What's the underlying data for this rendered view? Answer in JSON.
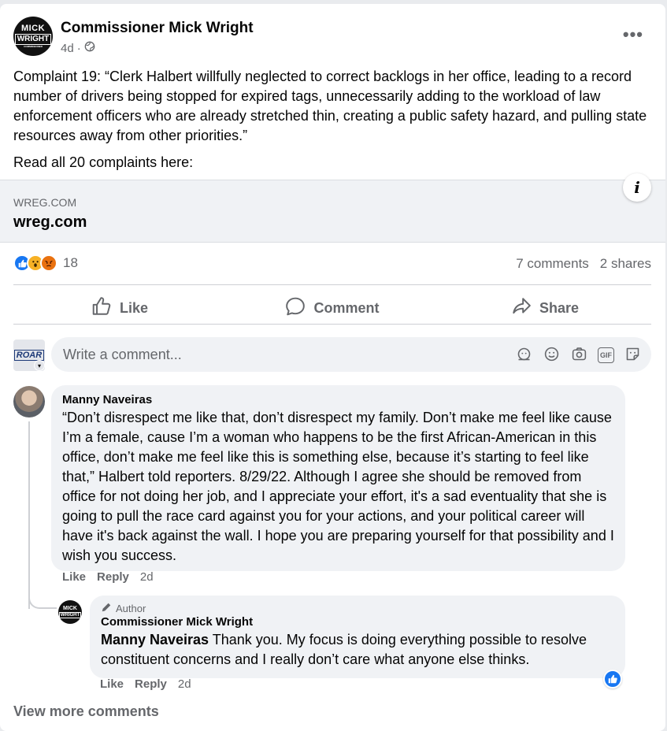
{
  "post": {
    "author": "Commissioner Mick Wright",
    "logo_line1": "MICK",
    "logo_line2": "WRIGHT",
    "logo_line3": "COMMISSIONER",
    "age": "4d",
    "separator": "·",
    "privacy_icon": "globe-icon",
    "more_icon": "more-icon",
    "more_label": "•••",
    "text": "Complaint 19: “Clerk Halbert willfully neglected to correct backlogs in her office, leading to a record number of drivers being stopped for expired tags, unnecessarily adding to the workload of law enforcement officers who are already stretched thin, creating a public safety hazard, and pulling state resources away from other priorities.”",
    "read_all": "Read all 20 complaints here:"
  },
  "link": {
    "domain": "WREG.COM",
    "title": "wreg.com",
    "info_label": "i"
  },
  "stats": {
    "reactions": [
      "like",
      "wow",
      "angry"
    ],
    "reaction_count": "18",
    "comments": "7 comments",
    "shares": "2 shares"
  },
  "actions": {
    "like": "Like",
    "comment": "Comment",
    "share": "Share"
  },
  "composer": {
    "placeholder": "Write a comment...",
    "avatar_text": "ROAR",
    "icons": [
      "avatar-sticker-icon",
      "emoji-icon",
      "camera-icon",
      "gif-icon",
      "sticker-icon"
    ],
    "gif_label": "GIF"
  },
  "comments": [
    {
      "name": "Manny Naveiras",
      "text": "“Don’t disrespect me like that, don’t disrespect my family. Don’t make me feel like cause I’m a female, cause I’m a woman who happens to be the first African-American in this office, don’t make me feel like this is something else, because it’s starting to feel like that,” Halbert told reporters. 8/29/22. Although I agree she should be removed from office for not doing her job, and I appreciate your effort, it's a sad eventuality that she is going to pull the race card against you for your actions, and your political career will have it's back against the wall. I hope you are preparing yourself for that possibility and I wish you success.",
      "like": "Like",
      "reply": "Reply",
      "age": "2d"
    }
  ],
  "reply": {
    "tag": "Author",
    "name": "Commissioner Mick Wright",
    "mention": "Manny Naveiras",
    "text": " Thank you. My focus is doing everything possible to resolve constituent concerns and I really don’t care what anyone else thinks.",
    "like": "Like",
    "reply": "Reply",
    "age": "2d",
    "avatar_line1": "MICK",
    "avatar_line2": "WRIGHT"
  },
  "view_more": "View more comments",
  "colors": {
    "brand_blue": "#1877f2",
    "secondary_text": "#65676b",
    "bubble_bg": "#f0f2f5"
  }
}
